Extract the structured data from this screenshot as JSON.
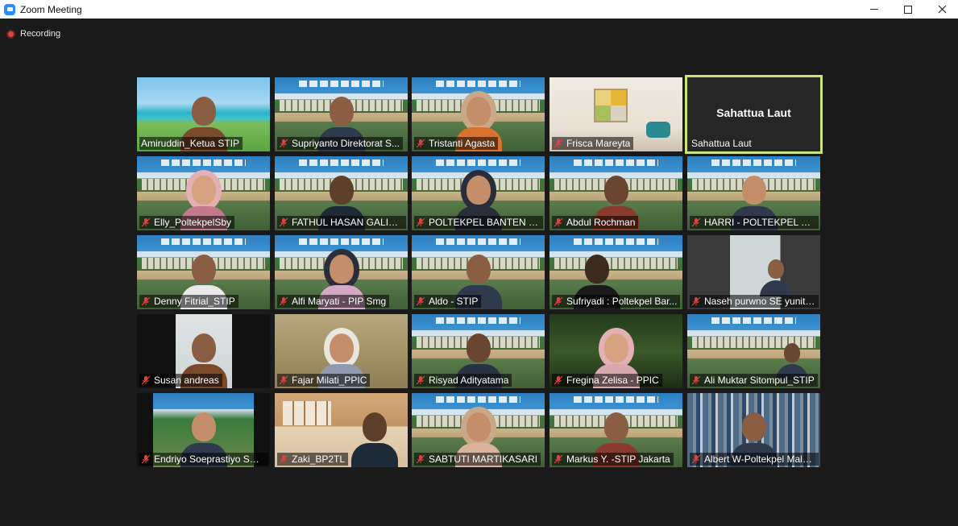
{
  "window": {
    "title": "Zoom Meeting"
  },
  "recording": {
    "label": "Recording"
  },
  "participants": [
    {
      "name": "Amiruddin_Ketua STIP"
    },
    {
      "name": "Supriyanto Direktorat S..."
    },
    {
      "name": "Tristanti Agasta"
    },
    {
      "name": "Frisca Mareyta"
    },
    {
      "name": "Sahattua Laut",
      "center_name": "Sahattua Laut"
    },
    {
      "name": "Elly_PoltekpelSby"
    },
    {
      "name": "FATHUL HASAN GALIB - ..."
    },
    {
      "name": "POLTEKPEL BANTEN _ A..."
    },
    {
      "name": "Abdul Rochman"
    },
    {
      "name": "HARRI - POLTEKPEL BAN..."
    },
    {
      "name": "Denny Fitrial_STIP"
    },
    {
      "name": "Alfi Maryati - PIP Smg"
    },
    {
      "name": "Aldo - STIP"
    },
    {
      "name": "Sufriyadi : Poltekpel Bar..."
    },
    {
      "name": "Naseh purwno SE yunit ..."
    },
    {
      "name": "Susan andreas"
    },
    {
      "name": "Fajar Milati_PPIC"
    },
    {
      "name": "Risyad Adityatama"
    },
    {
      "name": "Fregina Zelisa - PPIC"
    },
    {
      "name": "Ali Muktar Sitompul_STIP"
    },
    {
      "name": "Endriyo Soeprastiyo STTD"
    },
    {
      "name": "Zaki_BP2TL"
    },
    {
      "name": "SABTUTI MARTIKASARI"
    },
    {
      "name": "Markus Y. -STIP Jakarta"
    },
    {
      "name": "Albert W-Poltekpel Mala..."
    }
  ],
  "colors": {
    "active_speaker_border": "#c9e57a",
    "mute_icon": "#e34040",
    "record_dot": "#e34040"
  }
}
